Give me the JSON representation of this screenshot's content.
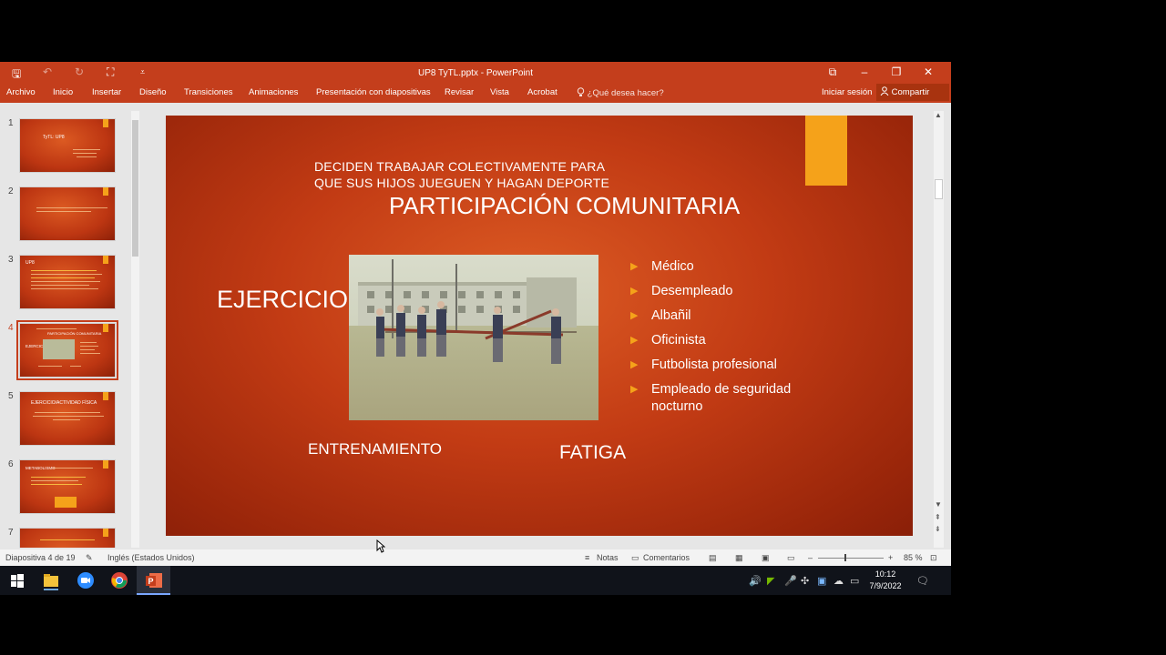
{
  "window": {
    "title": "UP8 TyTL.pptx - PowerPoint",
    "qat": {
      "save": "🖫",
      "undo": "↶",
      "redo": "↻",
      "present": "⛶",
      "customize": "⩡"
    },
    "controls": {
      "ribbon_display": "⧉",
      "minimize": "–",
      "maximize": "❐",
      "close": "✕"
    }
  },
  "ribbon": {
    "tabs": [
      "Archivo",
      "Inicio",
      "Insertar",
      "Diseño",
      "Transiciones",
      "Animaciones",
      "Presentación con diapositivas",
      "Revisar",
      "Vista",
      "Acrobat"
    ],
    "tell_me": "¿Qué desea hacer?",
    "sign_in": "Iniciar sesión",
    "share": "Compartir"
  },
  "thumbnails": {
    "numbers": [
      "1",
      "2",
      "3",
      "4",
      "5",
      "6",
      "7"
    ],
    "selected": 4,
    "slide1": {
      "title": "TyTL: UP8"
    },
    "slide3": {
      "title": "UP8"
    },
    "slide4": {
      "title": "PARTICIPACIÓN COMUNITARIA",
      "left": "EJERCICIO"
    },
    "slide5": {
      "title": "EJERCICIO/ACTIVIDAD FÍSICA"
    },
    "slide6": {
      "title": "METABOLISMO"
    }
  },
  "slide": {
    "subtitle_line1": "DECIDEN TRABAJAR COLECTIVAMENTE PARA",
    "subtitle_line2": "QUE SUS HIJOS JUEGUEN Y HAGAN DEPORTE",
    "title": "PARTICIPACIÓN COMUNITARIA",
    "left_word": "EJERCICIO",
    "bullets": [
      "Médico",
      "Desempleado",
      "Albañil",
      "Oficinista",
      "Futbolista profesional",
      "Empleado de seguridad nocturno"
    ],
    "bottom_left": "ENTRENAMIENTO",
    "bottom_right": "FATIGA",
    "colors": {
      "background": "#c23b14",
      "accent": "#f5a21a",
      "bullet_arrow": "#f5a21a"
    }
  },
  "status_bar": {
    "slide_info": "Diapositiva 4 de 19",
    "language": "Inglés (Estados Unidos)",
    "notes": "Notas",
    "comments": "Comentarios",
    "zoom": "85 %",
    "zoom_minus": "–",
    "zoom_plus": "+"
  },
  "taskbar": {
    "time": "10:12",
    "date": "7/9/2022",
    "apps": [
      "start-icon",
      "file-explorer-icon",
      "zoom-icon",
      "chrome-icon",
      "powerpoint-icon"
    ]
  }
}
